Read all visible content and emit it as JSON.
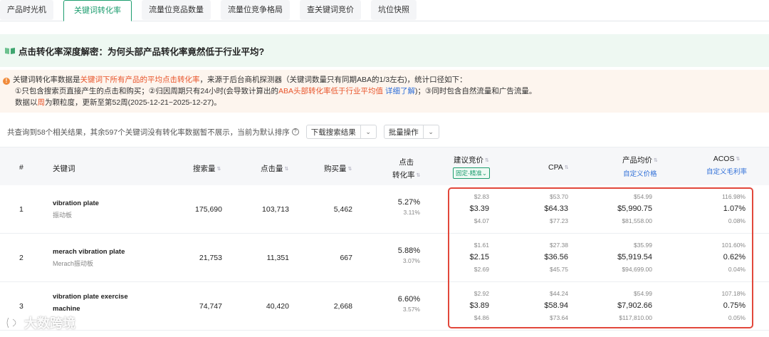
{
  "tabs": [
    {
      "label": "产品时光机",
      "active": false
    },
    {
      "label": "关键词转化率",
      "active": true
    },
    {
      "label": "流量位竞品数量",
      "active": false
    },
    {
      "label": "流量位竞争格局",
      "active": false
    },
    {
      "label": "查关键词竞价",
      "active": false
    },
    {
      "label": "坑位快照",
      "active": false
    }
  ],
  "banner": {
    "title": "点击转化率深度解密：为何头部产品转化率竟然低于行业平均?"
  },
  "notice": {
    "l1a": "关键词转化率数据是",
    "l1b": "关键词下所有产品的平均点击转化率",
    "l1c": "，来源于后台商机探测器（关键词数量只有同期ABA的1/3左右)，统计口径如下：",
    "l2a": "①只包含搜索页直接产生的点击和购买；②归因周期只有24小时(会导致计算出的",
    "l2b": "ABA头部转化率低于行业平均值",
    "l2c": " 详细了解",
    "l2d": ")；③同时包含自然流量和广告流量。",
    "l3a": "数据以",
    "l3b": "周",
    "l3c": "为颗粒度，更新至第52周(2025-12-21~2025-12-27)。"
  },
  "count_text": "共查询到58个相关结果，其余597个关键词没有转化率数据暂不展示，当前为默认排序",
  "buttons": {
    "download": "下载搜索结果",
    "batch": "批量操作",
    "dd": "⌄"
  },
  "headers": {
    "idx": "#",
    "keyword": "关键词",
    "search": "搜索量",
    "clicks": "点击量",
    "buys": "购买量",
    "cvr1": "点击",
    "cvr2": "转化率",
    "bid": "建议竞价",
    "bid_tag": "固定-精准⌄",
    "cpa": "CPA",
    "price": "产品均价",
    "price_sub": "自定义价格",
    "acos": "ACOS",
    "acos_sub": "自定义毛利率",
    "sort": "⇅"
  },
  "rows": [
    {
      "idx": "1",
      "kw": "vibration plate",
      "kw_cn": "振动板",
      "kw_line2": "",
      "search": "175,690",
      "clicks": "103,713",
      "buys": "5,462",
      "cvr": "5.27%",
      "cvr_sub": "3.11%",
      "bid": [
        "$2.83",
        "$3.39",
        "$4.07"
      ],
      "cpa": [
        "$53.70",
        "$64.33",
        "$77.23"
      ],
      "price": [
        "$54.99",
        "$5,990.75",
        "$81,558.00"
      ],
      "acos": [
        "116.98%",
        "1.07%",
        "0.08%"
      ]
    },
    {
      "idx": "2",
      "kw": "merach vibration plate",
      "kw_cn": "Merach振动板",
      "kw_line2": "",
      "search": "21,753",
      "clicks": "11,351",
      "buys": "667",
      "cvr": "5.88%",
      "cvr_sub": "3.07%",
      "bid": [
        "$1.61",
        "$2.15",
        "$2.69"
      ],
      "cpa": [
        "$27.38",
        "$36.56",
        "$45.75"
      ],
      "price": [
        "$35.99",
        "$5,919.54",
        "$94,699.00"
      ],
      "acos": [
        "101.60%",
        "0.62%",
        "0.04%"
      ]
    },
    {
      "idx": "3",
      "kw": "vibration plate exercise",
      "kw_cn": "",
      "kw_line2": "machine",
      "search": "74,747",
      "clicks": "40,420",
      "buys": "2,668",
      "cvr": "6.60%",
      "cvr_sub": "3.57%",
      "bid": [
        "$2.92",
        "$3.89",
        "$4.86"
      ],
      "cpa": [
        "$44.24",
        "$58.94",
        "$73.64"
      ],
      "price": [
        "$54.99",
        "$7,902.66",
        "$117,810.00"
      ],
      "acos": [
        "107.18%",
        "0.75%",
        "0.05%"
      ]
    }
  ],
  "watermark": "大数跨境",
  "colors": {
    "accent": "#1d9d6f",
    "highlight": "#e8542a",
    "link": "#2f6fd8",
    "redbox": "#e2473b"
  }
}
